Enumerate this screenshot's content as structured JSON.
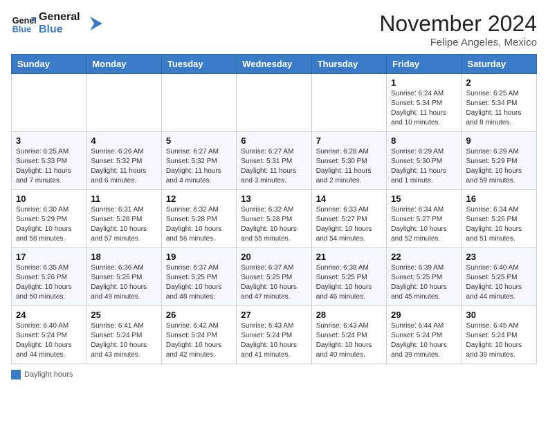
{
  "header": {
    "logo_line1": "General",
    "logo_line2": "Blue",
    "month_title": "November 2024",
    "location": "Felipe Angeles, Mexico"
  },
  "weekdays": [
    "Sunday",
    "Monday",
    "Tuesday",
    "Wednesday",
    "Thursday",
    "Friday",
    "Saturday"
  ],
  "weeks": [
    [
      {
        "day": "",
        "info": ""
      },
      {
        "day": "",
        "info": ""
      },
      {
        "day": "",
        "info": ""
      },
      {
        "day": "",
        "info": ""
      },
      {
        "day": "",
        "info": ""
      },
      {
        "day": "1",
        "info": "Sunrise: 6:24 AM\nSunset: 5:34 PM\nDaylight: 11 hours and 10 minutes."
      },
      {
        "day": "2",
        "info": "Sunrise: 6:25 AM\nSunset: 5:34 PM\nDaylight: 11 hours and 8 minutes."
      }
    ],
    [
      {
        "day": "3",
        "info": "Sunrise: 6:25 AM\nSunset: 5:33 PM\nDaylight: 11 hours and 7 minutes."
      },
      {
        "day": "4",
        "info": "Sunrise: 6:26 AM\nSunset: 5:32 PM\nDaylight: 11 hours and 6 minutes."
      },
      {
        "day": "5",
        "info": "Sunrise: 6:27 AM\nSunset: 5:32 PM\nDaylight: 11 hours and 4 minutes."
      },
      {
        "day": "6",
        "info": "Sunrise: 6:27 AM\nSunset: 5:31 PM\nDaylight: 11 hours and 3 minutes."
      },
      {
        "day": "7",
        "info": "Sunrise: 6:28 AM\nSunset: 5:30 PM\nDaylight: 11 hours and 2 minutes."
      },
      {
        "day": "8",
        "info": "Sunrise: 6:29 AM\nSunset: 5:30 PM\nDaylight: 11 hours and 1 minute."
      },
      {
        "day": "9",
        "info": "Sunrise: 6:29 AM\nSunset: 5:29 PM\nDaylight: 10 hours and 59 minutes."
      }
    ],
    [
      {
        "day": "10",
        "info": "Sunrise: 6:30 AM\nSunset: 5:29 PM\nDaylight: 10 hours and 58 minutes."
      },
      {
        "day": "11",
        "info": "Sunrise: 6:31 AM\nSunset: 5:28 PM\nDaylight: 10 hours and 57 minutes."
      },
      {
        "day": "12",
        "info": "Sunrise: 6:32 AM\nSunset: 5:28 PM\nDaylight: 10 hours and 56 minutes."
      },
      {
        "day": "13",
        "info": "Sunrise: 6:32 AM\nSunset: 5:28 PM\nDaylight: 10 hours and 55 minutes."
      },
      {
        "day": "14",
        "info": "Sunrise: 6:33 AM\nSunset: 5:27 PM\nDaylight: 10 hours and 54 minutes."
      },
      {
        "day": "15",
        "info": "Sunrise: 6:34 AM\nSunset: 5:27 PM\nDaylight: 10 hours and 52 minutes."
      },
      {
        "day": "16",
        "info": "Sunrise: 6:34 AM\nSunset: 5:26 PM\nDaylight: 10 hours and 51 minutes."
      }
    ],
    [
      {
        "day": "17",
        "info": "Sunrise: 6:35 AM\nSunset: 5:26 PM\nDaylight: 10 hours and 50 minutes."
      },
      {
        "day": "18",
        "info": "Sunrise: 6:36 AM\nSunset: 5:26 PM\nDaylight: 10 hours and 49 minutes."
      },
      {
        "day": "19",
        "info": "Sunrise: 6:37 AM\nSunset: 5:25 PM\nDaylight: 10 hours and 48 minutes."
      },
      {
        "day": "20",
        "info": "Sunrise: 6:37 AM\nSunset: 5:25 PM\nDaylight: 10 hours and 47 minutes."
      },
      {
        "day": "21",
        "info": "Sunrise: 6:38 AM\nSunset: 5:25 PM\nDaylight: 10 hours and 46 minutes."
      },
      {
        "day": "22",
        "info": "Sunrise: 6:39 AM\nSunset: 5:25 PM\nDaylight: 10 hours and 45 minutes."
      },
      {
        "day": "23",
        "info": "Sunrise: 6:40 AM\nSunset: 5:25 PM\nDaylight: 10 hours and 44 minutes."
      }
    ],
    [
      {
        "day": "24",
        "info": "Sunrise: 6:40 AM\nSunset: 5:24 PM\nDaylight: 10 hours and 44 minutes."
      },
      {
        "day": "25",
        "info": "Sunrise: 6:41 AM\nSunset: 5:24 PM\nDaylight: 10 hours and 43 minutes."
      },
      {
        "day": "26",
        "info": "Sunrise: 6:42 AM\nSunset: 5:24 PM\nDaylight: 10 hours and 42 minutes."
      },
      {
        "day": "27",
        "info": "Sunrise: 6:43 AM\nSunset: 5:24 PM\nDaylight: 10 hours and 41 minutes."
      },
      {
        "day": "28",
        "info": "Sunrise: 6:43 AM\nSunset: 5:24 PM\nDaylight: 10 hours and 40 minutes."
      },
      {
        "day": "29",
        "info": "Sunrise: 6:44 AM\nSunset: 5:24 PM\nDaylight: 10 hours and 39 minutes."
      },
      {
        "day": "30",
        "info": "Sunrise: 6:45 AM\nSunset: 5:24 PM\nDaylight: 10 hours and 39 minutes."
      }
    ]
  ],
  "footer": {
    "daylight_label": "Daylight hours"
  }
}
